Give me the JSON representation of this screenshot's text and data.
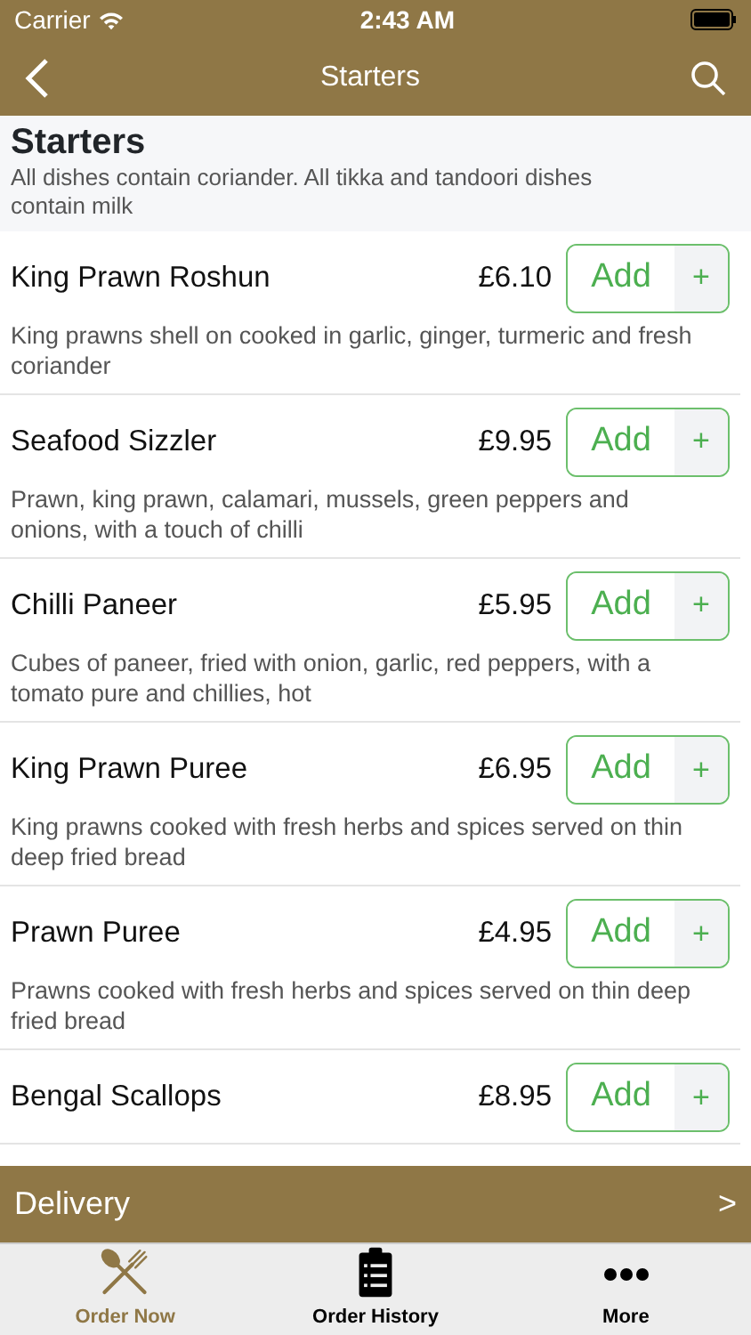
{
  "status_bar": {
    "carrier": "Carrier",
    "time": "2:43 AM"
  },
  "nav": {
    "title": "Starters"
  },
  "section": {
    "title": "Starters",
    "note": "All dishes contain coriander. All tikka and tandoori dishes contain milk"
  },
  "items": [
    {
      "name": "King Prawn Roshun",
      "price": "£6.10",
      "description": "King prawns shell on cooked in garlic, ginger, turmeric and fresh coriander",
      "add": "Add",
      "plus": "+"
    },
    {
      "name": "Seafood Sizzler",
      "price": "£9.95",
      "description": "Prawn, king prawn, calamari, mussels, green peppers and onions, with a touch of chilli",
      "add": "Add",
      "plus": "+"
    },
    {
      "name": "Chilli Paneer",
      "price": "£5.95",
      "description": "Cubes of paneer, fried with onion, garlic, red peppers, with a tomato pure and chillies, hot",
      "add": "Add",
      "plus": "+"
    },
    {
      "name": "King Prawn Puree",
      "price": "£6.95",
      "description": "King prawns cooked with fresh herbs and spices served on thin deep fried bread",
      "add": "Add",
      "plus": "+"
    },
    {
      "name": "Prawn Puree",
      "price": "£4.95",
      "description": "Prawns cooked with fresh herbs and spices served on thin deep fried bread",
      "add": "Add",
      "plus": "+"
    },
    {
      "name": "Bengal Scallops",
      "price": "£8.95",
      "add": "Add",
      "plus": "+"
    }
  ],
  "delivery_bar": {
    "label": "Delivery",
    "arrow": ">"
  },
  "tab_bar": [
    {
      "kind": "cutlery",
      "label": "Order Now",
      "selected": true
    },
    {
      "kind": "clipboard",
      "label": "Order History",
      "selected": false
    },
    {
      "kind": "dots",
      "label": "More",
      "selected": false
    }
  ]
}
